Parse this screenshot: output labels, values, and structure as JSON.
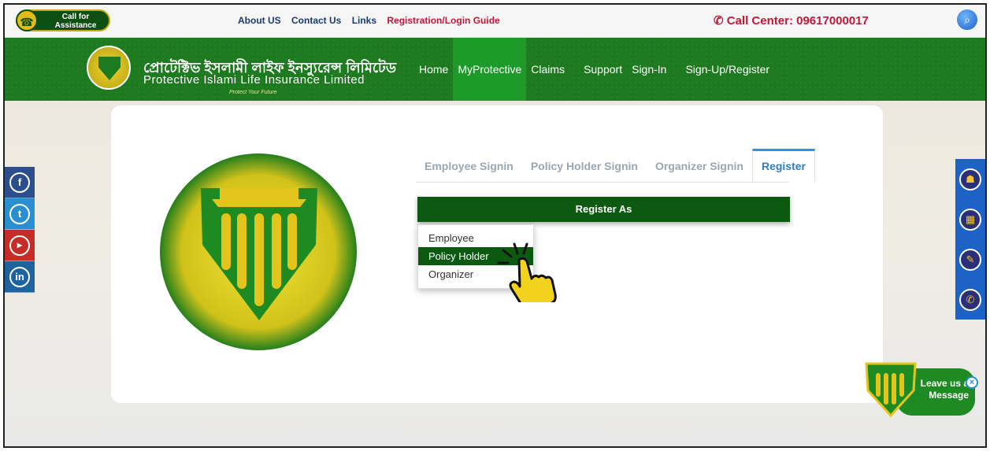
{
  "topbar": {
    "call_assist": "Call for Assistance",
    "links": [
      "About US",
      "Contact Us",
      "Links"
    ],
    "guide_link": "Registration/Login Guide",
    "call_center": "Call Center: 09617000017"
  },
  "brand": {
    "name_bn": "প্রোটেক্টিভ ইসলামী লাইফ ইনস্যুরেন্স লিমিটেড",
    "name_en": "Protective Islami Life Insurance Limited",
    "tagline": "Protect Your Future"
  },
  "nav": [
    "Home",
    "MyProtective",
    "Claims",
    "Support",
    "Sign-In",
    "Sign-Up/Register"
  ],
  "nav_active": "MyProtective",
  "tabs": [
    "Employee Signin",
    "Policy Holder Signin",
    "Organizer Signin",
    "Register"
  ],
  "tab_active": "Register",
  "register": {
    "button_label": "Register As",
    "options": [
      "Employee",
      "Policy Holder",
      "Organizer"
    ],
    "selected": "Policy Holder"
  },
  "social": [
    "facebook-icon",
    "twitter-icon",
    "youtube-icon",
    "linkedin-icon"
  ],
  "tools": [
    "agent-icon",
    "calculator-icon",
    "form-icon",
    "phone-icon"
  ],
  "chat": {
    "label": "Leave us a Message",
    "close": "×"
  },
  "colors": {
    "brand_green": "#1d7a1f",
    "dark_green": "#0c5a12",
    "accent_red": "#c2183a",
    "tab_blue": "#2f7fc0"
  }
}
